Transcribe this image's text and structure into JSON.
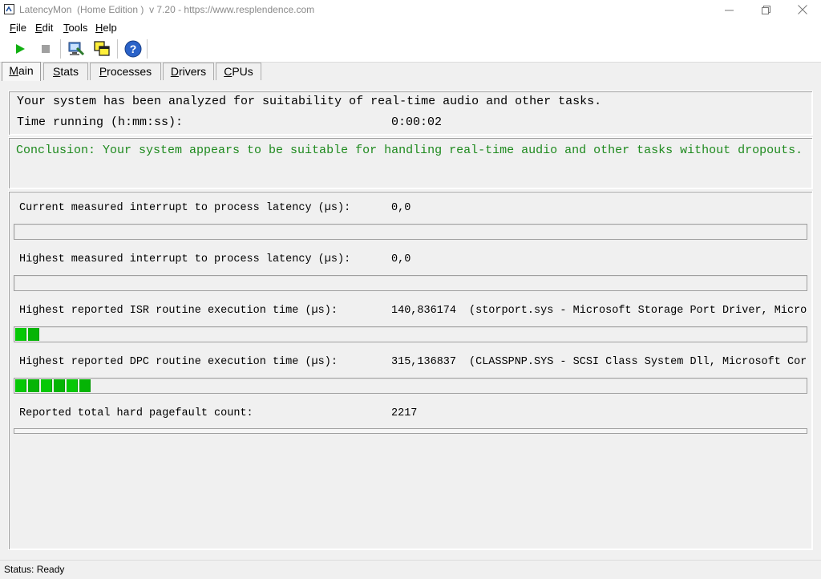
{
  "window": {
    "title": "LatencyMon  (Home Edition )  v 7.20 - https://www.resplendence.com"
  },
  "menu": [
    {
      "label": "File",
      "key": "F",
      "rest": "ile"
    },
    {
      "label": "Edit",
      "key": "E",
      "rest": "dit"
    },
    {
      "label": "Tools",
      "key": "T",
      "rest": "ools"
    },
    {
      "label": "Help",
      "key": "H",
      "rest": "elp"
    }
  ],
  "toolbar": {
    "icons": [
      "play-icon",
      "stop-icon",
      "computer-analyze-icon",
      "windows-icon",
      "help-icon"
    ]
  },
  "tabs": [
    {
      "label": "Main",
      "key": "M",
      "rest": "ain",
      "active": true
    },
    {
      "label": "Stats",
      "key": "S",
      "rest": "tats",
      "active": false
    },
    {
      "label": "Processes",
      "key": "P",
      "rest": "rocesses",
      "active": false
    },
    {
      "label": "Drivers",
      "key": "D",
      "rest": "rivers",
      "active": false
    },
    {
      "label": "CPUs",
      "key": "C",
      "rest": "PUs",
      "active": false
    }
  ],
  "summary": {
    "analyzed_text": "Your system has been analyzed for suitability of real-time audio and other tasks.",
    "time_label": "Time running (h:mm:ss):",
    "time_value": "0:00:02"
  },
  "conclusion": "Conclusion: Your system appears to be suitable for handling real-time audio and other tasks without dropouts.",
  "metrics": {
    "current_latency": {
      "label": "Current measured interrupt to process latency (µs):",
      "value": "0,0",
      "detail": "",
      "segments": 0
    },
    "highest_latency": {
      "label": "Highest measured interrupt to process latency (µs):",
      "value": "0,0",
      "detail": "",
      "segments": 0
    },
    "isr": {
      "label": "Highest reported ISR routine execution time (µs):",
      "value": "140,836174",
      "detail": "(storport.sys - Microsoft Storage Port Driver, Micros",
      "segments": 2
    },
    "dpc": {
      "label": "Highest reported DPC routine execution time (µs):",
      "value": "315,136837",
      "detail": "(CLASSPNP.SYS - SCSI Class System Dll, Microsoft Corp",
      "segments": 6
    },
    "pagefault": {
      "label": "Reported total hard pagefault count:",
      "value": "2217"
    }
  },
  "status": "Status: Ready",
  "colors": {
    "conclusion": "#1e8a1e",
    "bar_segment": "#06c806"
  }
}
